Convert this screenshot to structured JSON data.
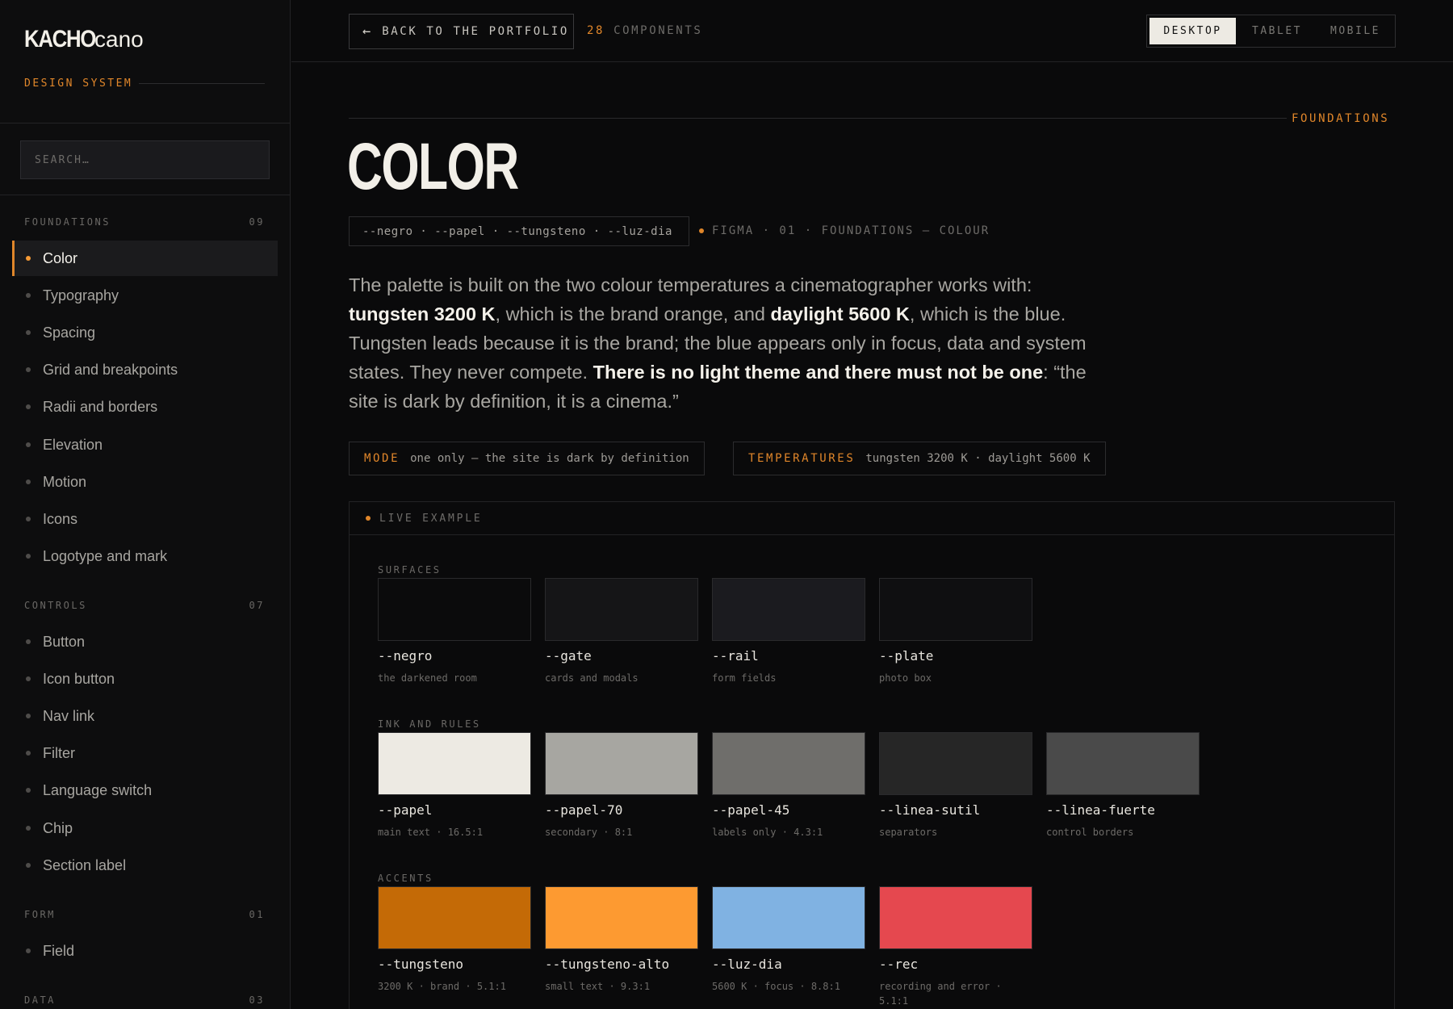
{
  "sidebar": {
    "brand_strong": "KACHO",
    "brand_light": "cano",
    "subtitle": "DESIGN SYSTEM",
    "search_placeholder": "SEARCH…",
    "groups": [
      {
        "title": "FOUNDATIONS",
        "count": "09",
        "items": [
          "Color",
          "Typography",
          "Spacing",
          "Grid and breakpoints",
          "Radii and borders",
          "Elevation",
          "Motion",
          "Icons",
          "Logotype and mark"
        ]
      },
      {
        "title": "CONTROLS",
        "count": "07",
        "items": [
          "Button",
          "Icon button",
          "Nav link",
          "Filter",
          "Language switch",
          "Chip",
          "Section label"
        ]
      },
      {
        "title": "FORM",
        "count": "01",
        "items": [
          "Field"
        ]
      },
      {
        "title": "DATA",
        "count": "03",
        "items": []
      }
    ],
    "active_item": "Color"
  },
  "topbar": {
    "back_label": "BACK TO THE PORTFOLIO",
    "component_count": "28",
    "component_label": "COMPONENTS",
    "viewports": [
      "DESKTOP",
      "TABLET",
      "MOBILE"
    ],
    "active_viewport": "DESKTOP"
  },
  "main": {
    "section_tag": "FOUNDATIONS",
    "title": "COLOR",
    "tokens": "--negro · --papel · --tungsteno · --luz-dia",
    "figma_ref": "FIGMA · 01 · FOUNDATIONS — COLOUR",
    "intro": {
      "p1": "The palette is built on the two colour temperatures a cinematographer works with: ",
      "b1": "tungsten 3200 K",
      "p2": ", which is the brand orange, and ",
      "b2": "daylight 5600 K",
      "p3": ", which is the blue. Tungsten leads because it is the brand; the blue appears only in focus, data and system states. They never compete. ",
      "b3": "There is no light theme and there must not be one",
      "p4": ": “the site is dark by definition, it is a cinema.”"
    },
    "pills": [
      {
        "key": "MODE",
        "value": "one only — the site is dark by definition"
      },
      {
        "key": "TEMPERATURES",
        "value": "tungsten 3200 K · daylight 5600 K"
      }
    ],
    "live_label": "LIVE EXAMPLE",
    "swatch_groups": [
      {
        "title": "SURFACES",
        "swatches": [
          {
            "name": "--negro",
            "desc": "the darkened room",
            "color": "#0b0b0c"
          },
          {
            "name": "--gate",
            "desc": "cards and modals",
            "color": "#151517"
          },
          {
            "name": "--rail",
            "desc": "form fields",
            "color": "#1b1b1f"
          },
          {
            "name": "--plate",
            "desc": "photo box",
            "color": "#0f0f11"
          }
        ]
      },
      {
        "title": "INK AND RULES",
        "swatches": [
          {
            "name": "--papel",
            "desc": "main text · 16.5:1",
            "color": "#edeae3"
          },
          {
            "name": "--papel-70",
            "desc": "secondary · 8:1",
            "color": "#a7a6a1"
          },
          {
            "name": "--papel-45",
            "desc": "labels only · 4.3:1",
            "color": "#6f6e6b"
          },
          {
            "name": "--linea-sutil",
            "desc": "separators",
            "color": "#262626"
          },
          {
            "name": "--linea-fuerte",
            "desc": "control borders",
            "color": "#4a4a4a"
          }
        ]
      },
      {
        "title": "ACCENTS",
        "swatches": [
          {
            "name": "--tungsteno",
            "desc": "3200 K · brand · 5.1:1",
            "color": "#c46a06"
          },
          {
            "name": "--tungsteno-alto",
            "desc": "small text · 9.3:1",
            "color": "#fd9a31"
          },
          {
            "name": "--luz-dia",
            "desc": "5600 K · focus · 8.8:1",
            "color": "#80b2e2"
          },
          {
            "name": "--rec",
            "desc": "recording and error · 5.1:1",
            "color": "#e5484f"
          }
        ]
      }
    ]
  }
}
